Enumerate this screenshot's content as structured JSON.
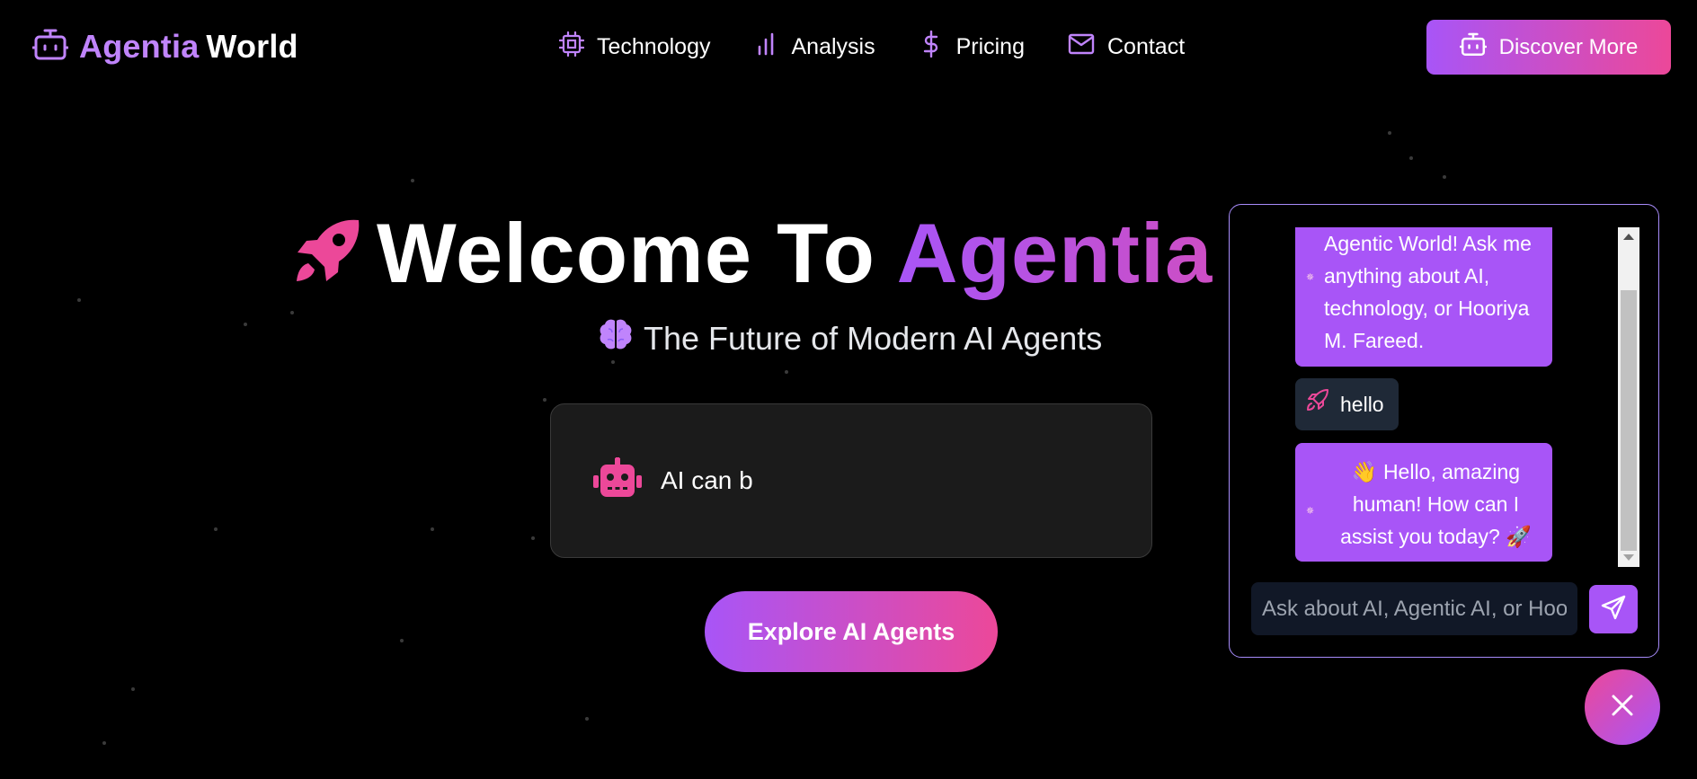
{
  "brand": {
    "part1": "Agentia",
    "part2": "World",
    "icon": "robot-icon"
  },
  "nav": {
    "links": [
      {
        "label": "Technology",
        "icon": "cpu-icon"
      },
      {
        "label": "Analysis",
        "icon": "bar-chart-icon"
      },
      {
        "label": "Pricing",
        "icon": "dollar-icon"
      },
      {
        "label": "Contact",
        "icon": "mail-icon"
      }
    ],
    "cta": {
      "label": "Discover More",
      "icon": "robot-icon"
    }
  },
  "hero": {
    "title_white": "Welcome To",
    "title_gradient": "Agentia World",
    "subtitle": "The Future of Modern AI Agents",
    "typing_text": "AI can b",
    "button": "Explore AI Agents"
  },
  "chat": {
    "messages": [
      {
        "role": "bot",
        "text": "Agentic World! Ask me anything about AI, technology, or Hooriya M. Fareed."
      },
      {
        "role": "user",
        "text": "hello",
        "icon": "rocket-icon"
      },
      {
        "role": "bot",
        "text": "👋 Hello, amazing human! How can I assist you today? 🚀"
      }
    ],
    "input_placeholder": "Ask about AI, Agentic AI, or Hooriya M. Fareed...",
    "send_icon": "send-icon",
    "close_icon": "close-icon"
  },
  "colors": {
    "purple": "#a855f7",
    "pink": "#ec4899",
    "light_purple": "#c084fc"
  }
}
